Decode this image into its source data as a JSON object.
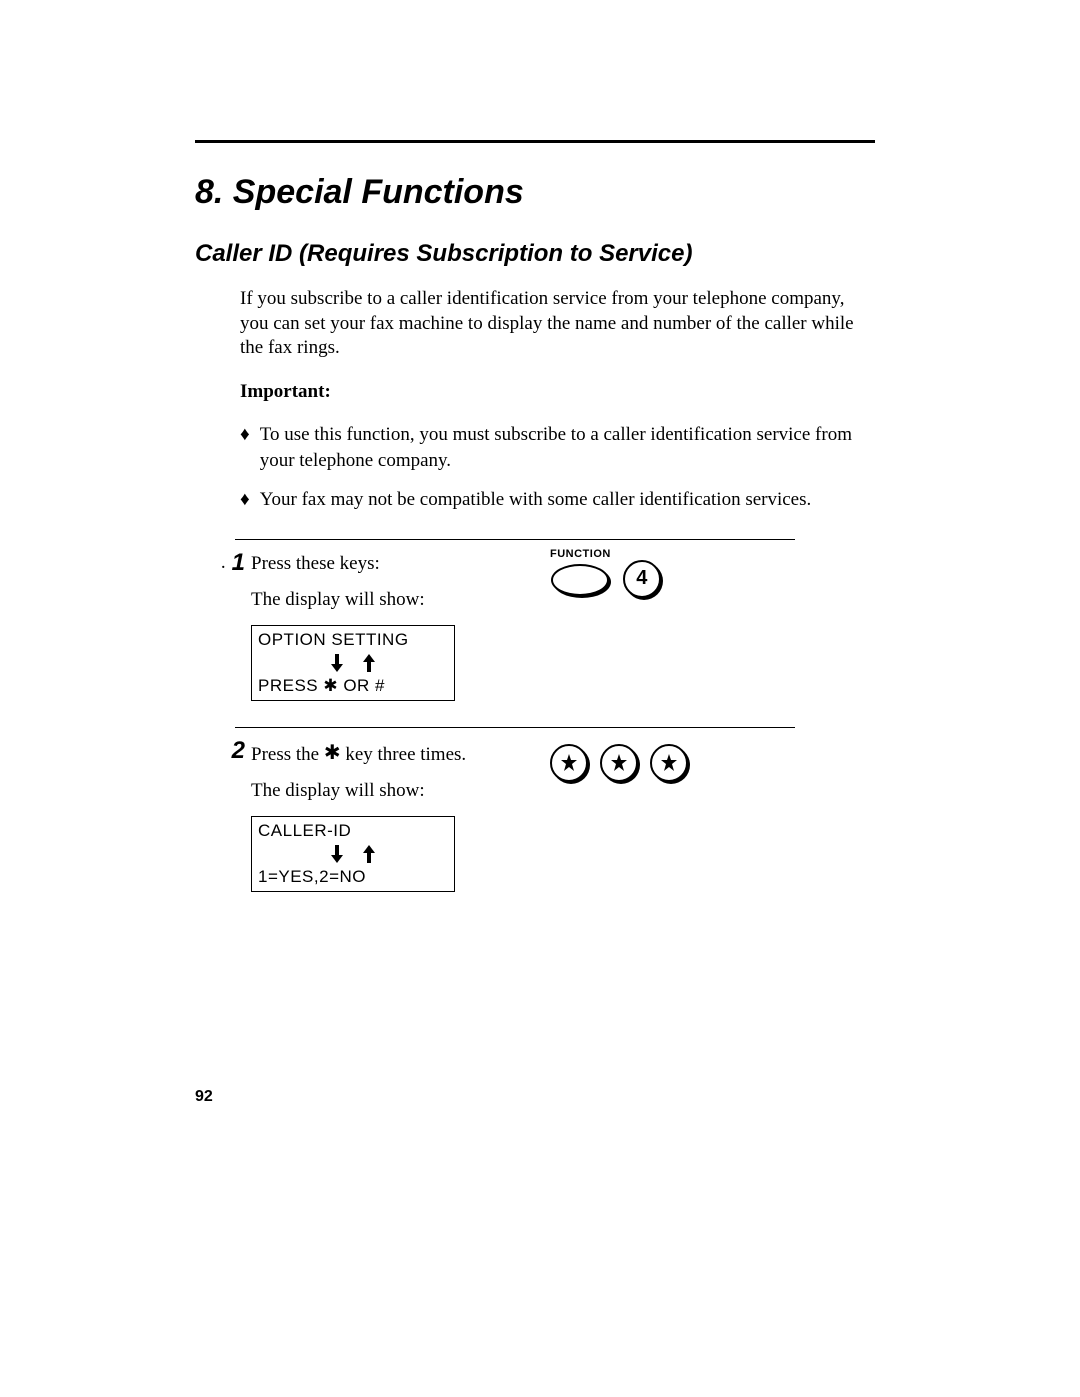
{
  "chapter_title": "8.  Special Functions",
  "section_title": "Caller ID (Requires Subscription to Service)",
  "intro": "If you subscribe to a caller identification service from your telephone company, you can set your fax machine to display the name and number of the caller while the fax rings.",
  "important_label": "Important:",
  "bullets": [
    "To use this function, you must subscribe to a caller identification service from your telephone company.",
    "Your fax may not be compatible with some caller identification services."
  ],
  "step1": {
    "num": "1",
    "dot": ".",
    "text1": "Press these keys:",
    "text2": "The display will show:",
    "lcd_line1": "OPTION SETTING",
    "lcd_line2": "PRESS ✱ OR #",
    "function_label": "FUNCTION",
    "key4": "4"
  },
  "step2": {
    "num": "2",
    "text1_a": "Press the ",
    "text1_b": " key three times.",
    "text2": "The display will show:",
    "lcd_line1": "CALLER-ID",
    "lcd_line2": "1=YES,2=NO"
  },
  "page_number": "92"
}
